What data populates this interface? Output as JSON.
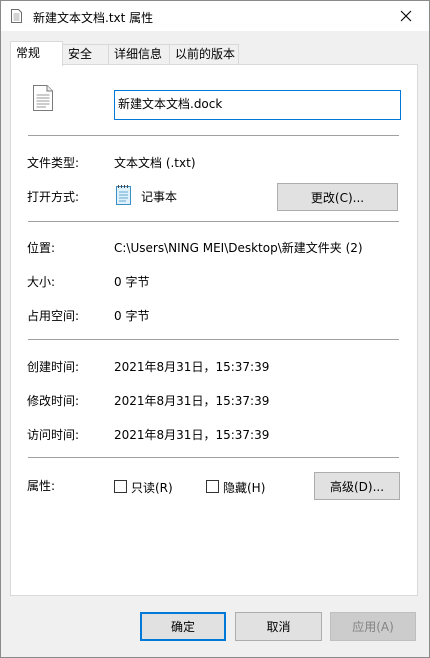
{
  "window": {
    "title": "新建文本文档.txt 属性"
  },
  "tabs": [
    "常规",
    "安全",
    "详细信息",
    "以前的版本"
  ],
  "general": {
    "file_name": "新建文本文档.dock",
    "type_label": "文件类型:",
    "type_value": "文本文档 (.txt)",
    "opens_with_label": "打开方式:",
    "opens_with_value": "记事本",
    "change_button": "更改(C)...",
    "location_label": "位置:",
    "location_value": "C:\\Users\\NING MEI\\Desktop\\新建文件夹 (2)",
    "size_label": "大小:",
    "size_value": "0 字节",
    "size_on_disk_label": "占用空间:",
    "size_on_disk_value": "0 字节",
    "created_label": "创建时间:",
    "created_value": "2021年8月31日，15:37:39",
    "modified_label": "修改时间:",
    "modified_value": "2021年8月31日，15:37:39",
    "accessed_label": "访问时间:",
    "accessed_value": "2021年8月31日，15:37:39",
    "attributes_label": "属性:",
    "readonly_label": "只读(R)",
    "hidden_label": "隐藏(H)",
    "advanced_button": "高级(D)..."
  },
  "footer": {
    "ok_button": "确定",
    "cancel_button": "取消",
    "apply_button": "应用(A)"
  },
  "colors": {
    "accent": "#0078d7",
    "panel_bg": "#ffffff",
    "dialog_bg": "#f0f0f0"
  }
}
